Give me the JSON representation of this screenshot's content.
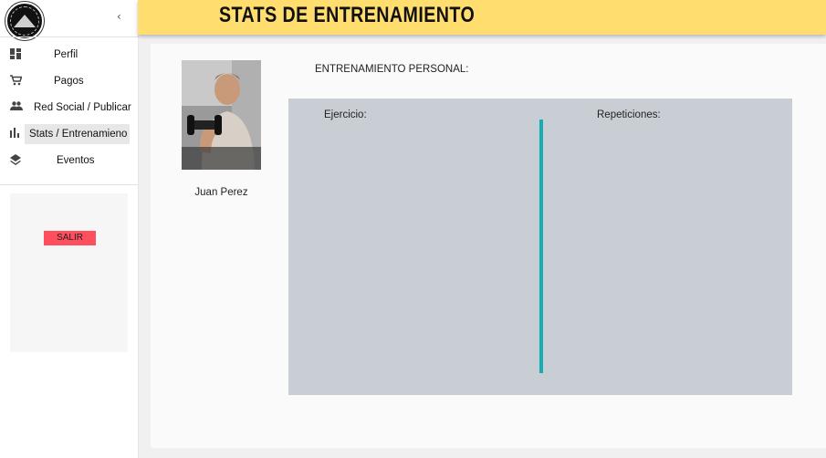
{
  "sidebar": {
    "collapse_icon": "chevron-left-icon",
    "items": [
      {
        "label": "Perfil",
        "icon": "dashboard-icon"
      },
      {
        "label": "Pagos",
        "icon": "cart-icon"
      },
      {
        "label": "Red Social / Publicar",
        "icon": "people-icon"
      },
      {
        "label": "Stats / Entrenamieno",
        "icon": "bar-chart-icon",
        "active": true
      },
      {
        "label": "Eventos",
        "icon": "layers-icon"
      }
    ],
    "logout_label": "SALIR",
    "logout_color": "#ff4f5f"
  },
  "header": {
    "title": "STATS DE ENTRENAMIENTO",
    "background": "#ffdd6e"
  },
  "profile": {
    "name": "Juan Perez"
  },
  "training": {
    "section_title": "ENTRENAMIENTO PERSONAL:",
    "columns": [
      "Ejercicio:",
      "Repeticiones:"
    ],
    "divider_color": "#14aeb2",
    "table_background": "#c8ced4"
  }
}
